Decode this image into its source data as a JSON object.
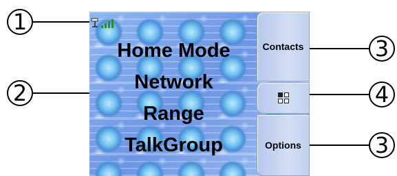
{
  "callouts": {
    "c1": "1",
    "c2": "2",
    "c3_top": "3",
    "c4": "4",
    "c3_bottom": "3"
  },
  "status_bar": {
    "antenna_icon": "antenna-icon",
    "signal_icon": "signal-bars-icon",
    "signal_level": 4
  },
  "mode_lines": [
    "Home Mode",
    "Network",
    "Range",
    "TalkGroup"
  ],
  "softkeys": {
    "top_label": "Contacts",
    "middle_icon": "menu-grid-icon",
    "bottom_label": "Options"
  },
  "colors": {
    "screen_background": "#6f9ee8",
    "softkey_background": "#c2d1ef",
    "signal": "#2f8a2f"
  }
}
